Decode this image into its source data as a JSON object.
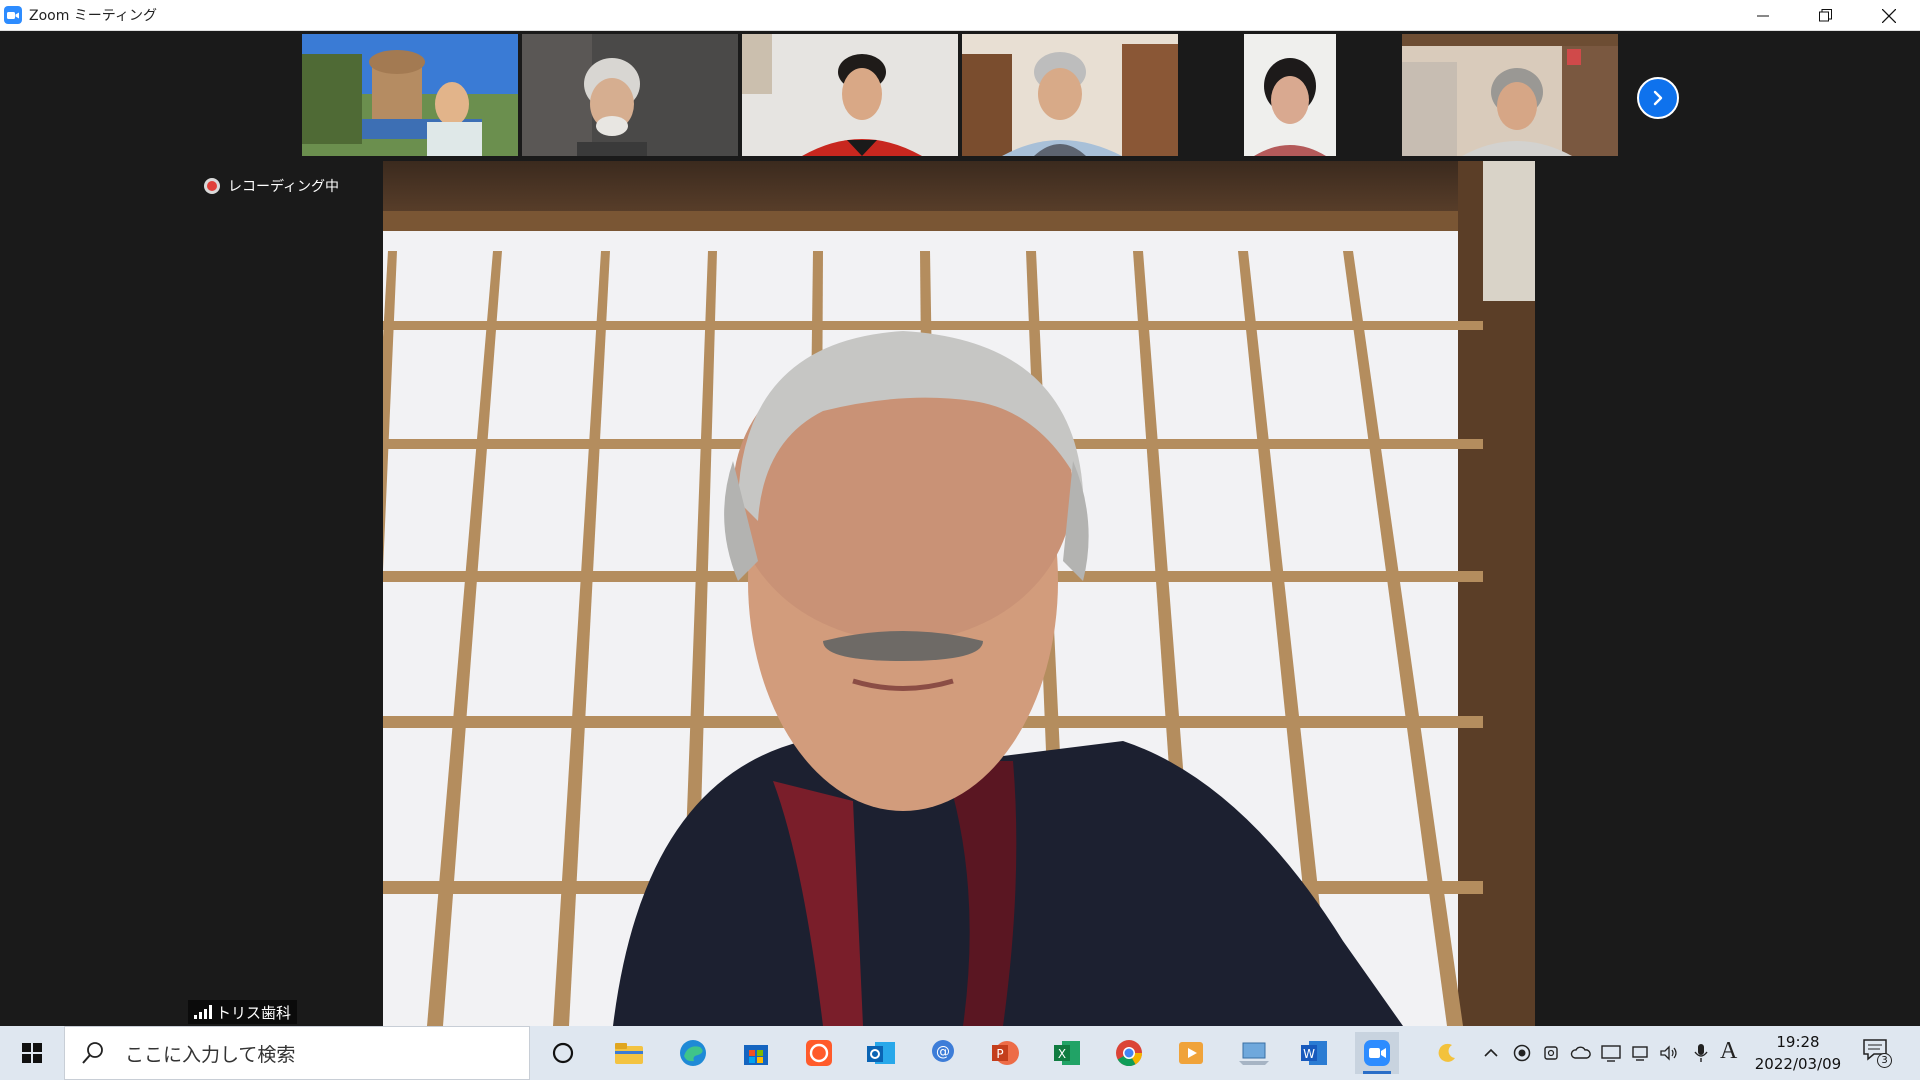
{
  "window": {
    "title": "Zoom ミーティング"
  },
  "recording": {
    "label": "レコーディング中"
  },
  "speaker": {
    "name": "トリス歯科"
  },
  "thumbnails": [
    {
      "id": "participant-1"
    },
    {
      "id": "participant-2"
    },
    {
      "id": "participant-3"
    },
    {
      "id": "participant-4"
    },
    {
      "id": "participant-5"
    },
    {
      "id": "participant-6"
    }
  ],
  "taskbar": {
    "search_placeholder": "ここに入力して検索",
    "apps": [
      "cortana",
      "file-explorer",
      "edge",
      "store",
      "app-orange",
      "outlook",
      "mail-menu",
      "powerpoint",
      "excel",
      "chrome",
      "media-player",
      "laptop-app",
      "word",
      "zoom"
    ],
    "active_app": "zoom"
  },
  "tray": {
    "time": "19:28",
    "date": "2022/03/09",
    "ime_mode": "A",
    "notification_count": "3"
  },
  "colors": {
    "zoom_blue": "#2d8cff",
    "next_button": "#0e72ed",
    "recording_red": "#e0403a",
    "taskbar_bg": "#dfe7f0"
  }
}
